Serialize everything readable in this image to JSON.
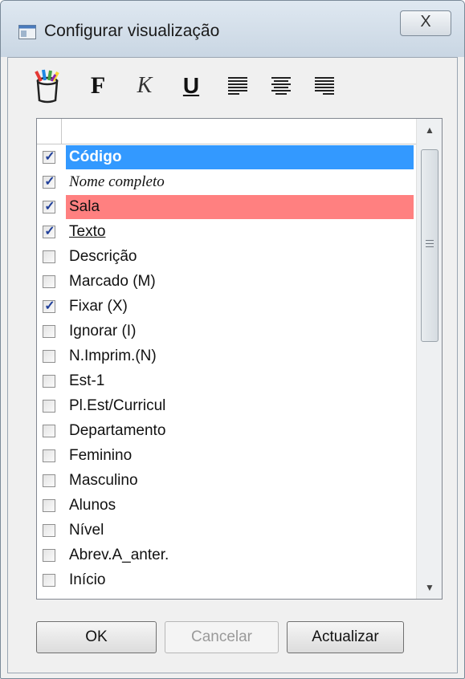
{
  "window": {
    "title": "Configurar visualização",
    "close_label": "X"
  },
  "toolbar": {
    "color_icon": "paint-bucket-icon",
    "bold_label": "F",
    "italic_label": "K",
    "underline_label": "U",
    "align_left_icon": "align-left-icon",
    "align_center_icon": "align-center-icon",
    "align_right_icon": "align-right-icon"
  },
  "list": {
    "items": [
      {
        "label": "Código",
        "checked": true,
        "style": "bold",
        "highlight": "#3399ff"
      },
      {
        "label": "Nome completo",
        "checked": true,
        "style": "italic",
        "highlight": ""
      },
      {
        "label": "Sala",
        "checked": true,
        "style": "normal",
        "highlight": "#ff8080"
      },
      {
        "label": "Texto",
        "checked": true,
        "style": "underline",
        "highlight": ""
      },
      {
        "label": "Descrição",
        "checked": false,
        "style": "normal",
        "highlight": ""
      },
      {
        "label": "Marcado (M)",
        "checked": false,
        "style": "normal",
        "highlight": ""
      },
      {
        "label": "Fixar (X)",
        "checked": true,
        "style": "normal",
        "highlight": ""
      },
      {
        "label": "Ignorar (I)",
        "checked": false,
        "style": "normal",
        "highlight": ""
      },
      {
        "label": "N.Imprim.(N)",
        "checked": false,
        "style": "normal",
        "highlight": ""
      },
      {
        "label": "Est-1",
        "checked": false,
        "style": "normal",
        "highlight": ""
      },
      {
        "label": "Pl.Est/Curricul",
        "checked": false,
        "style": "normal",
        "highlight": ""
      },
      {
        "label": "Departamento",
        "checked": false,
        "style": "normal",
        "highlight": ""
      },
      {
        "label": "Feminino",
        "checked": false,
        "style": "normal",
        "highlight": ""
      },
      {
        "label": "Masculino",
        "checked": false,
        "style": "normal",
        "highlight": ""
      },
      {
        "label": "Alunos",
        "checked": false,
        "style": "normal",
        "highlight": ""
      },
      {
        "label": "Nível",
        "checked": false,
        "style": "normal",
        "highlight": ""
      },
      {
        "label": "Abrev.A_anter.",
        "checked": false,
        "style": "normal",
        "highlight": ""
      },
      {
        "label": "Início",
        "checked": false,
        "style": "normal",
        "highlight": ""
      }
    ]
  },
  "buttons": {
    "ok_label": "OK",
    "cancel_label": "Cancelar",
    "cancel_enabled": false,
    "update_label": "Actualizar"
  }
}
